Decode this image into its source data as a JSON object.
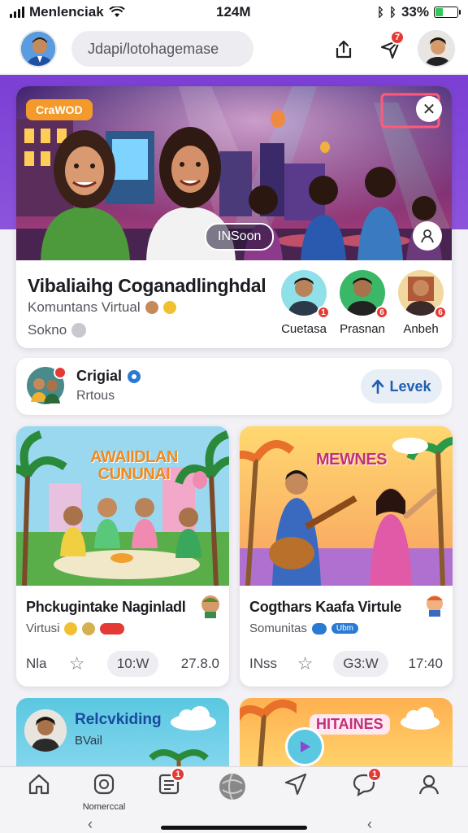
{
  "status": {
    "carrier": "Menlenciak",
    "time": "124M",
    "battery": "33%",
    "battery_level": 0.33
  },
  "header": {
    "search_placeholder": "Jdapi/lotohagemase",
    "notif_badge": "7"
  },
  "hero": {
    "tag": "CraWOD",
    "pill": "INSoon",
    "title": "Vibaliaihg Coganadlinghdal",
    "subtitle": "Komuntans Virtual",
    "meta": "Sokno",
    "members": [
      {
        "name": "Cuetasa",
        "badge": "1"
      },
      {
        "name": "Prasnan",
        "badge": "6"
      },
      {
        "name": "Anbeh",
        "badge": "6"
      }
    ]
  },
  "group": {
    "name": "Crigial",
    "sub": "Rrtous",
    "action": "Levek"
  },
  "cards": [
    {
      "img_title": "AWAIIDLAN CUNUNAI",
      "title": "Phckugintake Naginladl",
      "sub": "Virtusi",
      "foot_left": "Nla",
      "stat": "10:W",
      "foot_right": "27.8.0"
    },
    {
      "img_title": "MEWNES",
      "title": "Cogthars Kaafa Virtule",
      "sub": "Somunitas",
      "tag": "Ubm",
      "foot_left": "INss",
      "stat": "G3:W",
      "foot_right": "17:40"
    },
    {
      "title": "Relcvkiding",
      "sub": "BVail"
    },
    {
      "img_title": "HITAINES"
    }
  ],
  "bottom_nav": {
    "label": "Nomerccal",
    "badge1": "1",
    "badge2": "1"
  }
}
